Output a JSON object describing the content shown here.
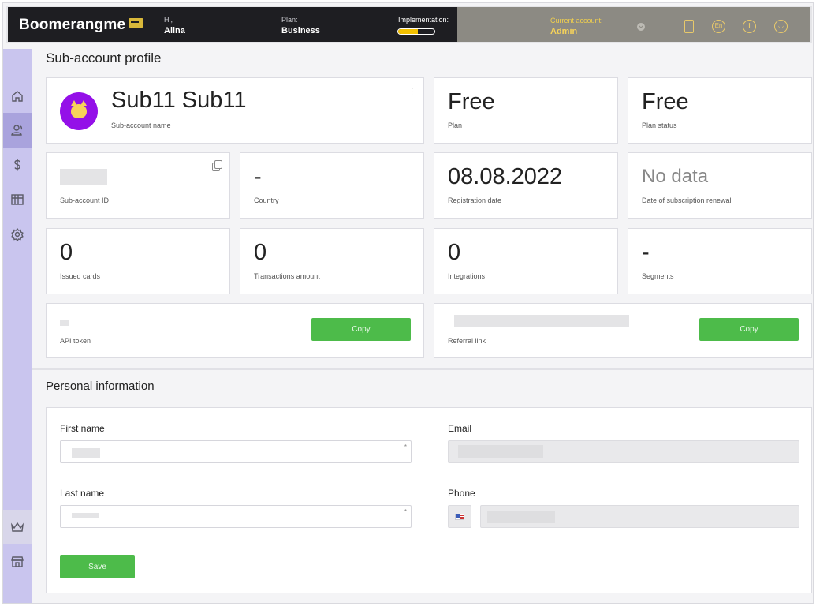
{
  "header": {
    "logo": "Boomerangme",
    "greeting_label": "Hi,",
    "user_name": "Alina",
    "plan_label": "Plan:",
    "plan_value": "Business",
    "implementation_label": "Implementation:",
    "implementation_progress": 0.55,
    "current_account_label": "Current account:",
    "current_account_value": "Admin",
    "language_badge": "En"
  },
  "profile": {
    "section_title": "Sub-account profile",
    "name": "Sub11 Sub11",
    "name_label": "Sub-account name",
    "plan": "Free",
    "plan_label": "Plan",
    "plan_status": "Free",
    "plan_status_label": "Plan status",
    "id_label": "Sub-account ID",
    "country": "-",
    "country_label": "Country",
    "registration_date": "08.08.2022",
    "registration_label": "Registration date",
    "renewal": "No data",
    "renewal_label": "Date of subscription renewal",
    "issued_cards": "0",
    "issued_cards_label": "Issued cards",
    "transactions": "0",
    "transactions_label": "Transactions amount",
    "integrations": "0",
    "integrations_label": "Integrations",
    "segments": "-",
    "segments_label": "Segments",
    "api_token_label": "API token",
    "referral_label": "Referral link",
    "copy_button": "Copy"
  },
  "personal": {
    "section_title": "Personal information",
    "first_name_label": "First name",
    "last_name_label": "Last name",
    "email_label": "Email",
    "phone_label": "Phone",
    "required_mark": "*",
    "save_button": "Save"
  },
  "colors": {
    "accent_green": "#4dbb4a",
    "sidebar": "#c9c5ee",
    "header_dark": "#1e1e22",
    "header_gold": "#f5d25a"
  }
}
